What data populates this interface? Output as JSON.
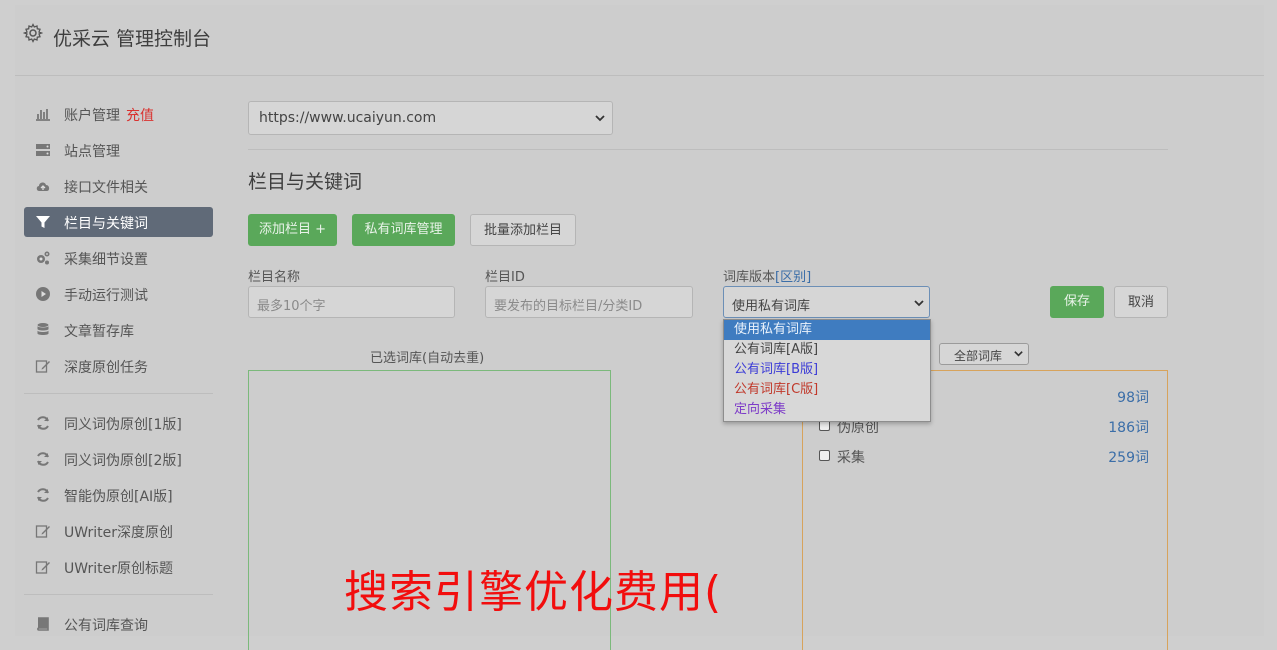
{
  "header": {
    "title": "优采云 管理控制台",
    "icon": "gear-icon"
  },
  "sidebar": {
    "items": [
      {
        "label": "账户管理",
        "extra": "充值",
        "icon": "bar-chart-icon"
      },
      {
        "label": "站点管理",
        "icon": "server-icon"
      },
      {
        "label": "接口文件相关",
        "icon": "cloud-upload-icon"
      },
      {
        "label": "栏目与关键词",
        "icon": "filter-icon",
        "active": true
      },
      {
        "label": "采集细节设置",
        "icon": "cogs-icon"
      },
      {
        "label": "手动运行测试",
        "icon": "play-circle-icon"
      },
      {
        "label": "文章暂存库",
        "icon": "database-icon"
      },
      {
        "label": "深度原创任务",
        "icon": "edit-icon"
      },
      {
        "label": "同义词伪原创[1版]",
        "icon": "refresh-icon"
      },
      {
        "label": "同义词伪原创[2版]",
        "icon": "refresh-icon"
      },
      {
        "label": "智能伪原创[AI版]",
        "icon": "refresh-icon"
      },
      {
        "label": "UWriter深度原创",
        "icon": "edit-icon"
      },
      {
        "label": "UWriter原创标题",
        "icon": "edit-icon"
      },
      {
        "label": "公有词库查询",
        "icon": "book-icon"
      }
    ]
  },
  "main": {
    "site_select": "https://www.ucaiyun.com",
    "section_title": "栏目与关键词",
    "buttons": {
      "add_column": "添加栏目 +",
      "private_lib": "私有词库管理",
      "batch_add": "批量添加栏目",
      "save": "保存",
      "cancel": "取消"
    },
    "form": {
      "name_label": "栏目名称",
      "name_placeholder": "最多10个字",
      "id_label": "栏目ID",
      "id_placeholder": "要发布的目标栏目/分类ID",
      "version_label": "词库版本",
      "version_link": "[区别]",
      "version_value": "使用私有词库"
    },
    "dropdown_options": [
      {
        "label": "使用私有词库",
        "color": "#eaf2fb",
        "selected": true
      },
      {
        "label": "公有词库[A版]",
        "color": "#444444"
      },
      {
        "label": "公有词库[B版]",
        "color": "#3b3bd6"
      },
      {
        "label": "公有词库[C版]",
        "color": "#c0392b"
      },
      {
        "label": "定向采集",
        "color": "#7d3cc8"
      }
    ],
    "selected_lib_title": "已选词库(自动去重)",
    "lib_filter": "全部词库",
    "libraries": [
      {
        "name": "",
        "count": "98词"
      },
      {
        "name": "伪原创",
        "count": "186词"
      },
      {
        "name": "采集",
        "count": "259词"
      }
    ]
  },
  "watermark": "搜索引擎优化费用("
}
